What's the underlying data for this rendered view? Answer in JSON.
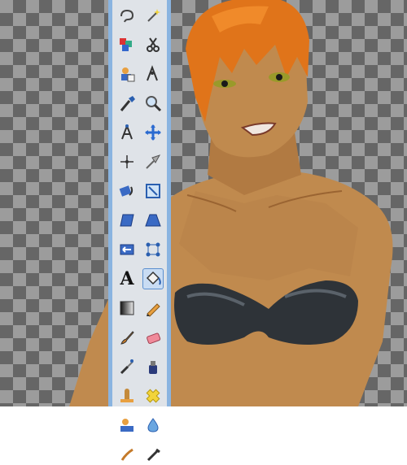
{
  "canvas": {
    "checker_dark": "#666666",
    "checker_light": "#9c9c9c"
  },
  "toolbox": {
    "border_color": "#8ab4e0",
    "background": "#dfe3e8",
    "active_tool": "bucket-fill-tool",
    "tools": [
      {
        "name": "free-select-lasso-icon"
      },
      {
        "name": "fuzzy-select-wand-icon"
      },
      {
        "name": "select-by-color-icon"
      },
      {
        "name": "scissors-select-icon"
      },
      {
        "name": "foreground-select-icon"
      },
      {
        "name": "paths-icon"
      },
      {
        "name": "color-picker-icon"
      },
      {
        "name": "zoom-icon"
      },
      {
        "name": "measure-compass-icon"
      },
      {
        "name": "move-icon"
      },
      {
        "name": "align-icon"
      },
      {
        "name": "crop-knife-icon"
      },
      {
        "name": "rotate-icon"
      },
      {
        "name": "scale-icon"
      },
      {
        "name": "shear-icon"
      },
      {
        "name": "perspective-icon"
      },
      {
        "name": "flip-icon"
      },
      {
        "name": "cage-transform-icon"
      },
      {
        "name": "text-tool-icon",
        "glyph": "A"
      },
      {
        "name": "bucket-fill-icon"
      },
      {
        "name": "blend-gradient-icon"
      },
      {
        "name": "pencil-icon"
      },
      {
        "name": "paintbrush-icon"
      },
      {
        "name": "eraser-icon"
      },
      {
        "name": "airbrush-icon"
      },
      {
        "name": "ink-icon"
      },
      {
        "name": "clone-stamp-icon"
      },
      {
        "name": "heal-icon"
      },
      {
        "name": "perspective-clone-icon"
      },
      {
        "name": "blur-drop-icon"
      },
      {
        "name": "smudge-icon"
      },
      {
        "name": "dodge-burn-icon"
      }
    ]
  },
  "artwork": {
    "hair_color": "#e0741a",
    "skin_color": "#c08a4e",
    "skin_shadow": "#a06a3a",
    "top_color": "#2e3338"
  }
}
